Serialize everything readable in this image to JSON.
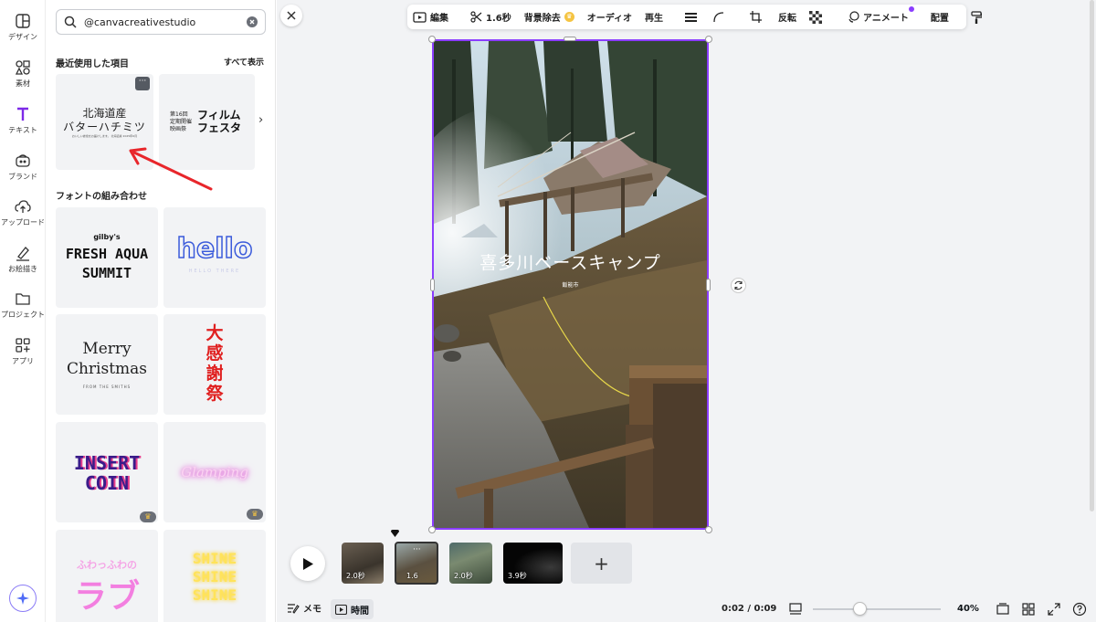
{
  "rail": {
    "items": [
      {
        "label": "デザイン",
        "icon": "design-icon"
      },
      {
        "label": "素材",
        "icon": "elements-icon"
      },
      {
        "label": "テキスト",
        "icon": "text-icon"
      },
      {
        "label": "ブランド",
        "icon": "brand-icon"
      },
      {
        "label": "アップロード",
        "icon": "upload-icon"
      },
      {
        "label": "お絵描き",
        "icon": "draw-icon"
      },
      {
        "label": "プロジェクト",
        "icon": "folder-icon"
      },
      {
        "label": "アプリ",
        "icon": "apps-icon"
      }
    ],
    "accent": "#7d2ae8"
  },
  "panel": {
    "search_value": "@canvacreativestudio",
    "recent_title": "最近使用した項目",
    "see_all": "すべて表示",
    "recent_cards": [
      {
        "line1": "北海道産",
        "line2": "バターハチミツ",
        "fine": "おいしい蜂蜜をお届けします。 北海道産 2025年6月"
      },
      {
        "small1": "第16回",
        "small2": "定期開催",
        "small3": "映画祭",
        "big1": "フィルム",
        "big2": "フェスタ"
      }
    ],
    "font_title": "フォントの組み合わせ",
    "font_cards": [
      {
        "top": "gilby's",
        "l1": "FRESH AQUA",
        "l2": "SUMMIT"
      },
      {
        "word": "hello",
        "sub": "HELLO THERE"
      },
      {
        "l1": "Merry",
        "l2": "Christmas",
        "sub": "FROM THE SMITHS"
      },
      {
        "chars": "大感謝祭"
      },
      {
        "l1": "INSERT",
        "l2": "COIN"
      },
      {
        "word": "Glamping"
      },
      {
        "small": "ふわっふわの",
        "big": "ラブ"
      },
      {
        "l1": "SHINE",
        "l2": "SHINE",
        "l3": "SHINE"
      }
    ]
  },
  "toolbar": {
    "edit": "編集",
    "duration": "1.6秒",
    "bg_remove": "背景除去",
    "audio": "オーディオ",
    "playback": "再生",
    "flip": "反転",
    "animate": "アニメート",
    "position": "配置"
  },
  "canvas": {
    "overlay_title": "喜多川ベースキャンプ",
    "overlay_sub": "飯能市"
  },
  "timeline": {
    "clips": [
      {
        "duration": "2.0秒"
      },
      {
        "duration": "1.6"
      },
      {
        "duration": "2.0秒"
      },
      {
        "duration": "3.9秒"
      }
    ],
    "add": "+"
  },
  "footer": {
    "notes": "メモ",
    "time": "時間",
    "readout": "0:02 / 0:09",
    "zoom": "40%",
    "zoom_fraction": 0.4
  }
}
